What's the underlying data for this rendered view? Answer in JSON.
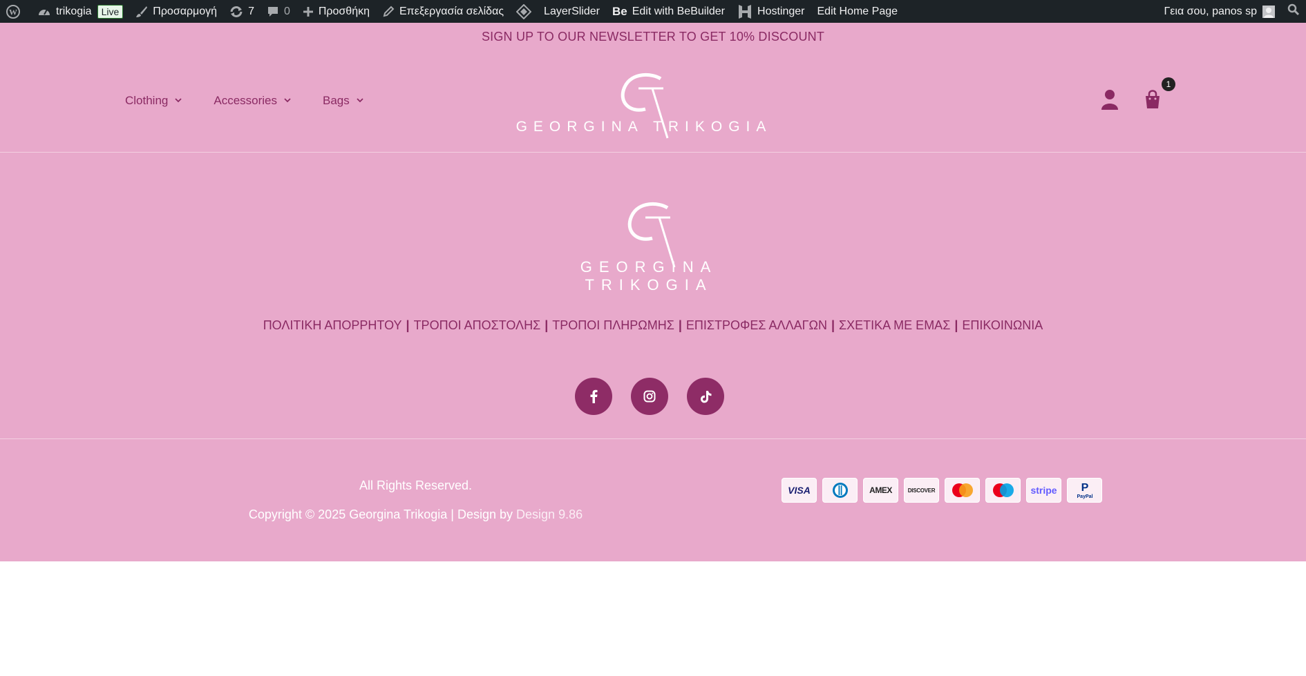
{
  "adminbar": {
    "site_name": "trikogia",
    "live_label": "Live",
    "customize_label": "Προσαρμογή",
    "updates_count": "7",
    "comments_count": "0",
    "new_label": "Προσθήκη",
    "edit_page_label": "Επεξεργασία σελίδας",
    "layerslider_label": "LayerSlider",
    "bebuilder_label": "Edit with BeBuilder",
    "hostinger_label": "Hostinger",
    "edit_home_label": "Edit Home Page",
    "greeting": "Γεια σου, panos sp"
  },
  "header": {
    "newsletter": "SIGN UP TO OUR NEWSLETTER TO GET 10% DISCOUNT",
    "nav": [
      {
        "label": "Clothing"
      },
      {
        "label": "Accessories"
      },
      {
        "label": "Bags"
      }
    ],
    "logo_text": "GEORGINA TRIKOGIA",
    "cart_count": "1"
  },
  "footer": {
    "logo_text": "GEORGINA TRIKOGIA",
    "links": [
      "ΠΟΛΙΤΙΚΗ ΑΠΟΡΡΗΤΟΥ",
      "ΤΡΟΠΟΙ ΑΠΟΣΤΟΛΗΣ",
      "ΤΡΟΠΟΙ ΠΛΗΡΩΜΗΣ",
      "ΕΠΙΣΤΡΟΦΕΣ ΑΛΛΑΓΩΝ",
      "ΣΧΕΤΙΚΑ ΜΕ ΕΜΑΣ",
      "ΕΠΙΚΟΙΝΩΝΙΑ"
    ],
    "separator": "|",
    "rights": "All Rights Reserved.",
    "copyright": "Copyright © 2025 Georgina Trikogia | Design by",
    "designer": "Design 9.86",
    "payments": [
      "VISA",
      "Diners Club",
      "AMEX",
      "DISCOVER",
      "Mastercard",
      "Maestro",
      "stripe",
      "PayPal"
    ]
  },
  "colors": {
    "pink_bg": "#e8a9cb",
    "brand_plum": "#8a2a63",
    "adminbar": "#1d2327"
  }
}
